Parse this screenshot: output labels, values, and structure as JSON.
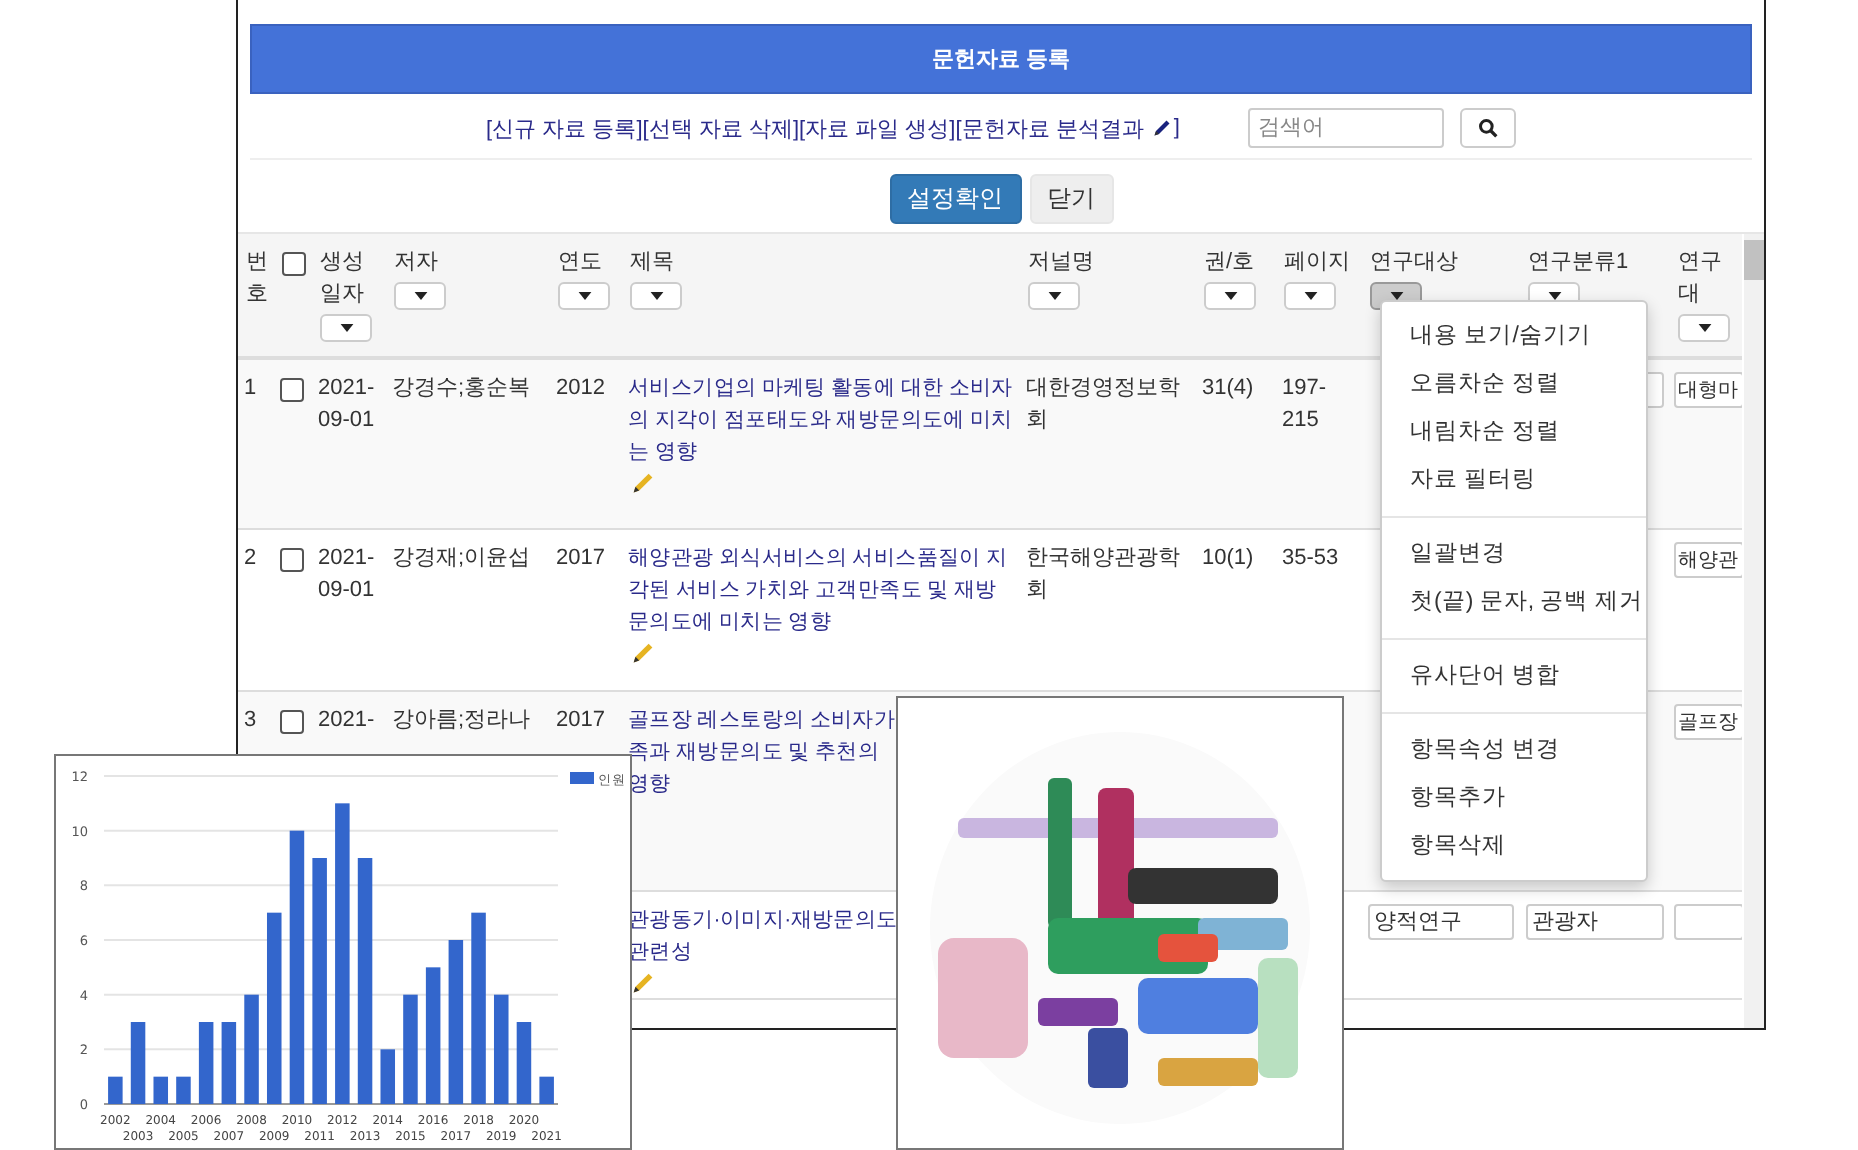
{
  "window": {
    "title": "문헌자료 등록"
  },
  "toolbar": {
    "links": [
      {
        "label": "[신규 자료 등록]",
        "kind": "text"
      },
      {
        "label": "[선택 자료 삭제]",
        "kind": "text"
      },
      {
        "label": "[자료 파일 생성]",
        "kind": "text"
      },
      {
        "label": "[문헌자료 분석결과",
        "kind": "icon",
        "close": "]"
      }
    ],
    "search": {
      "placeholder": "검색어"
    }
  },
  "buttons": [
    {
      "label": "설정확인",
      "kind": "primary"
    },
    {
      "label": "닫기",
      "kind": "default"
    }
  ],
  "table": {
    "columns": [
      {
        "label": "번호",
        "kind": "plain"
      },
      {
        "kind": "checkbox",
        "checked": false
      },
      {
        "label": "생성일자",
        "kind": "filter",
        "selected": false
      },
      {
        "label": "저자",
        "kind": "filter",
        "selected": false
      },
      {
        "label": "연도",
        "kind": "filter",
        "selected": false
      },
      {
        "label": "제목",
        "kind": "filter",
        "selected": false
      },
      {
        "label": "저널명",
        "kind": "filter",
        "selected": false
      },
      {
        "label": "권/호",
        "kind": "filter",
        "selected": false
      },
      {
        "label": "페이지",
        "kind": "filter",
        "selected": false
      },
      {
        "label": "연구대상",
        "kind": "filter",
        "selected": true
      },
      {
        "label": "연구분류1",
        "kind": "filter",
        "selected": false
      },
      {
        "label": "연구대",
        "kind": "filter",
        "selected": false
      }
    ],
    "rows": [
      {
        "number": "1",
        "checked": false,
        "date": "2021-09-01",
        "author": "강경수;홍순복",
        "year": "2012",
        "title": "서비스기업의 마케팅 활동에 대한 소비자의 지각이 점포태도와 재방문의도에 미치는 영향",
        "editable": true,
        "journal": "대한경영정보학회",
        "volume": "31(4)",
        "pages": "197-215",
        "category_input": {
          "kind": "input"
        },
        "extra_input": {
          "kind": "input",
          "value": "대형마"
        }
      },
      {
        "number": "2",
        "checked": false,
        "date": "2021-09-01",
        "author": "강경재;이윤섭",
        "year": "2017",
        "title": "해양관광 외식서비스의 서비스품질이 지각된 서비스 가치와 고객만족도 및 재방문의도에 미치는 영향",
        "editable": true,
        "journal": "한국해양관광학회",
        "volume": "10(1)",
        "pages": "35-53",
        "extra_input": {
          "kind": "input",
          "value": "해양관"
        }
      },
      {
        "number": "3",
        "checked": false,
        "date": "2021-",
        "author": "강아름;정라나",
        "year": "2017",
        "title": "골프장 레스토랑의 소비자가\n족과 재방문의도 및 추천의\n영향",
        "editable": false,
        "extra_input": {
          "kind": "input",
          "value": "골프장"
        }
      },
      {
        "title": "관광동기·이미지·재방문의도\n관련성",
        "editable": true,
        "target_input": {
          "kind": "input",
          "value": "양적연구"
        },
        "category_input": {
          "kind": "input",
          "value": "관광자"
        },
        "extra_input": {
          "kind": "input"
        }
      }
    ]
  },
  "context_menu": {
    "groups": [
      {
        "items": [
          "내용 보기/숨기기",
          "오름차순 정렬",
          "내림차순 정렬",
          "자료 필터링"
        ]
      },
      {
        "items": [
          "일괄변경",
          "첫(끝) 문자, 공백 제거"
        ]
      },
      {
        "items": [
          "유사단어 병합"
        ]
      },
      {
        "items": [
          "항목속성 변경",
          "항목추가",
          "항목삭제"
        ]
      }
    ]
  },
  "chart_panel": {
    "chart_data": {
      "type": "bar",
      "categories": [
        "2002",
        "2003",
        "2004",
        "2005",
        "2006",
        "2007",
        "2008",
        "2009",
        "2010",
        "2011",
        "2012",
        "2013",
        "2014",
        "2015",
        "2016",
        "2017",
        "2018",
        "2019",
        "2020",
        "2021"
      ],
      "series": [
        {
          "name": "인원",
          "color": "#3366cc",
          "values": [
            1,
            3,
            1,
            1,
            3,
            3,
            4,
            7,
            10,
            9,
            11,
            9,
            2,
            4,
            5,
            6,
            7,
            4,
            3,
            1
          ]
        }
      ],
      "ylim": [
        0,
        12
      ],
      "yticks": [
        0,
        2,
        4,
        6,
        8,
        10,
        12
      ],
      "grid": true
    }
  }
}
